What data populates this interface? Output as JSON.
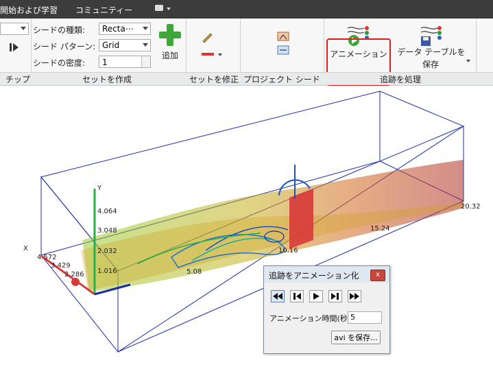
{
  "topbar": {
    "tab_left": "開始および学習",
    "tab_community": "コミュニティー"
  },
  "ribbon": {
    "seed_type_label": "シードの種類:",
    "seed_type_value": "Recta⋯",
    "seed_pattern_label": "シード パターン:",
    "seed_pattern_value": "Grid",
    "seed_density_label": "シードの密度:",
    "seed_density_value": "1",
    "add_label": "追加",
    "animation_label": "アニメーション",
    "save_table_label_1": "データ テーブルを",
    "save_table_label_2": "保存",
    "groups": {
      "tips": "チップ",
      "create_set": "セットを作成",
      "modify_set": "セットを修正",
      "project_seed": "プロジェクト シード",
      "process_trace": "追跡を処理"
    }
  },
  "viewport": {
    "axis_x": "X",
    "axis_y": "Y",
    "y_ticks": [
      "4.064",
      "3.048",
      "2.032",
      "1.016"
    ],
    "x_ticks": [
      "4.572",
      "3.429",
      "2.286"
    ],
    "z_ticks": [
      "5.08",
      "10.16",
      "15.24",
      "20.32"
    ]
  },
  "dialog": {
    "title": "追跡をアニメーション化",
    "close": "x",
    "time_label": "アニメーション時間(秒)",
    "time_value": "5",
    "save_avi": "avi を保存..."
  },
  "colors": {
    "highlight": "#e01b1b",
    "box": "#1a2bb0",
    "plate": "#d83a3a"
  }
}
